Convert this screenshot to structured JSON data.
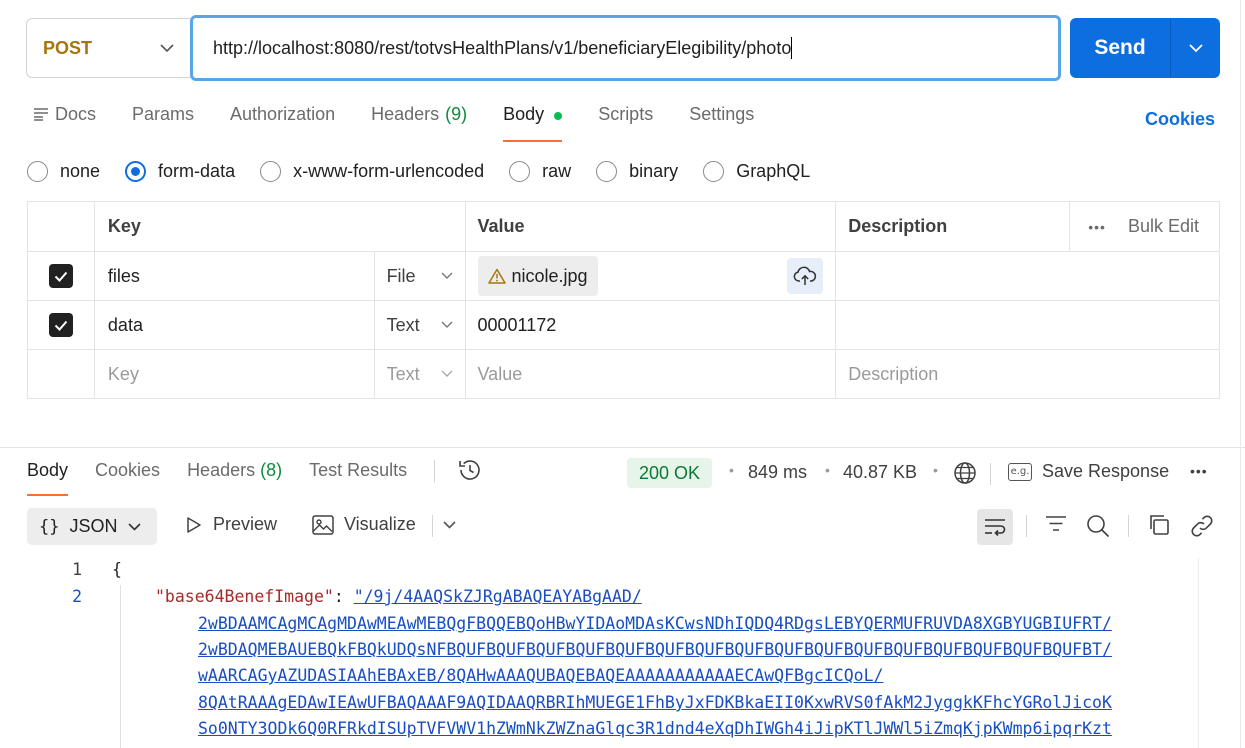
{
  "request": {
    "method": "POST",
    "url": "http://localhost:8080/rest/totvsHealthPlans/v1/beneficiaryElegibility/photo",
    "send_label": "Send"
  },
  "request_tabs": [
    {
      "label": "Docs"
    },
    {
      "label": "Params"
    },
    {
      "label": "Authorization"
    },
    {
      "label": "Headers",
      "count": "(9)"
    },
    {
      "label": "Body"
    },
    {
      "label": "Scripts"
    },
    {
      "label": "Settings"
    }
  ],
  "cookies_label": "Cookies",
  "body_types": [
    "none",
    "form-data",
    "x-www-form-urlencoded",
    "raw",
    "binary",
    "GraphQL"
  ],
  "body_type_selected": "form-data",
  "table": {
    "headers": {
      "key": "Key",
      "value": "Value",
      "description": "Description",
      "bulk_edit": "Bulk Edit"
    },
    "rows": [
      {
        "checked": true,
        "key": "files",
        "type": "File",
        "value": "nicole.jpg",
        "description": ""
      },
      {
        "checked": true,
        "key": "data",
        "type": "Text",
        "value": "00001172",
        "description": ""
      }
    ],
    "placeholder": {
      "key": "Key",
      "type": "Text",
      "value": "Value",
      "description": "Description"
    }
  },
  "response": {
    "tabs": [
      {
        "label": "Body"
      },
      {
        "label": "Cookies"
      },
      {
        "label": "Headers",
        "count": "(8)"
      },
      {
        "label": "Test Results"
      }
    ],
    "status": "200 OK",
    "time": "849 ms",
    "size": "40.87 KB",
    "save_label": "Save Response",
    "format": "JSON",
    "preview_label": "Preview",
    "visualize_label": "Visualize",
    "code": {
      "line1_number": "1",
      "line1_text": "{",
      "line2_number": "2",
      "key": "\"base64BenefImage\"",
      "value_lines": [
        "\"/9j/4AAQSkZJRgABAQEAYABgAAD/",
        "2wBDAAMCAgMCAgMDAwMEAwMEBQgFBQQEBQoHBwYIDAoMDAsKCwsNDhIQDQ4RDgsLEBYQERMUFRUVDA8XGBYUGBIUFRT/",
        "2wBDAQMEBAUEBQkFBQkUDQsNFBQUFBQUFBQUFBQUFBQUFBQUFBQUFBQUFBQUFBQUFBQUFBQUFBQUFBQUFBQUFBQUFBT/",
        "wAARCAGyAZUDASIAAhEBAxEB/8QAHwAAAQUBAQEBAQEAAAAAAAAAAAECAwQFBgcICQoL/",
        "8QAtRAAAgEDAwIEAwUFBAQAAAF9AQIDAAQRBRIhMUEGE1FhByJxFDKBkaEII0KxwRVS0fAkM2JyggkKFhcYGRolJicoK",
        "So0NTY3ODk6Q0RFRkdISUpTVFVWV1hZWmNkZWZnaGlqc3R1dnd4eXqDhIWGh4iJipKTlJWWl5iZmqKjpKWmp6ipqrKzt"
      ]
    }
  },
  "colors": {
    "method": "#a6750c",
    "send": "#0d6ee0",
    "accent_tab": "#ff6c37",
    "status_ok": "#0b7a35",
    "link": "#1a4dc2",
    "json_key": "#a52a2a"
  }
}
